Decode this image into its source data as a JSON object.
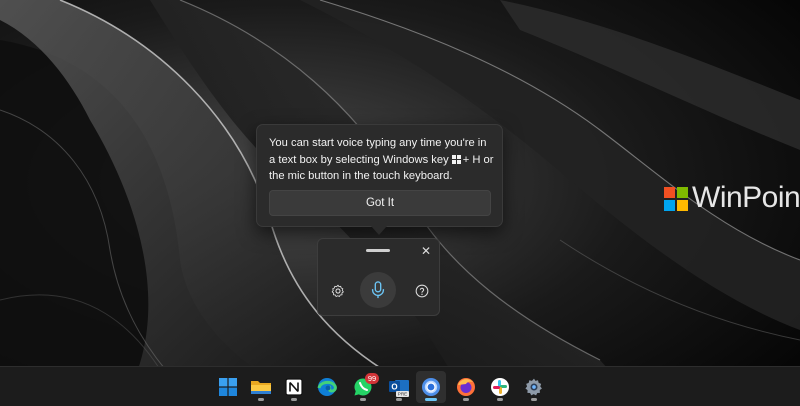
{
  "tooltip": {
    "line_before_key": "You can start voice typing any time you're in a text box by selecting Windows key",
    "line_after_key": "+ H or the mic button in the touch keyboard.",
    "button_label": "Got It"
  },
  "watermark": {
    "text": "WinPoin",
    "logo_colors": [
      "#f25022",
      "#7fba00",
      "#00a4ef",
      "#ffb900"
    ]
  },
  "voice_panel": {
    "buttons": [
      "settings",
      "microphone",
      "help"
    ],
    "close_symbol": "✕"
  },
  "taskbar": {
    "items": [
      {
        "name": "start",
        "icon": "windows-logo-icon"
      },
      {
        "name": "file-explorer",
        "icon": "folder-icon"
      },
      {
        "name": "notion",
        "icon": "notion-icon"
      },
      {
        "name": "edge",
        "icon": "edge-icon"
      },
      {
        "name": "whatsapp",
        "icon": "whatsapp-icon",
        "badge": "99"
      },
      {
        "name": "outlook",
        "icon": "outlook-icon",
        "badge": "PRE"
      },
      {
        "name": "chrome",
        "icon": "chrome-icon",
        "active": true
      },
      {
        "name": "firefox",
        "icon": "firefox-icon"
      },
      {
        "name": "slack",
        "icon": "slack-icon"
      },
      {
        "name": "settings",
        "icon": "settings-gear-icon"
      }
    ]
  },
  "colors": {
    "accent": "#6cc5f5",
    "flyout_bg": "#2b2b2b",
    "taskbar_bg": "#1c1c1c",
    "badge_red": "#d13438"
  }
}
